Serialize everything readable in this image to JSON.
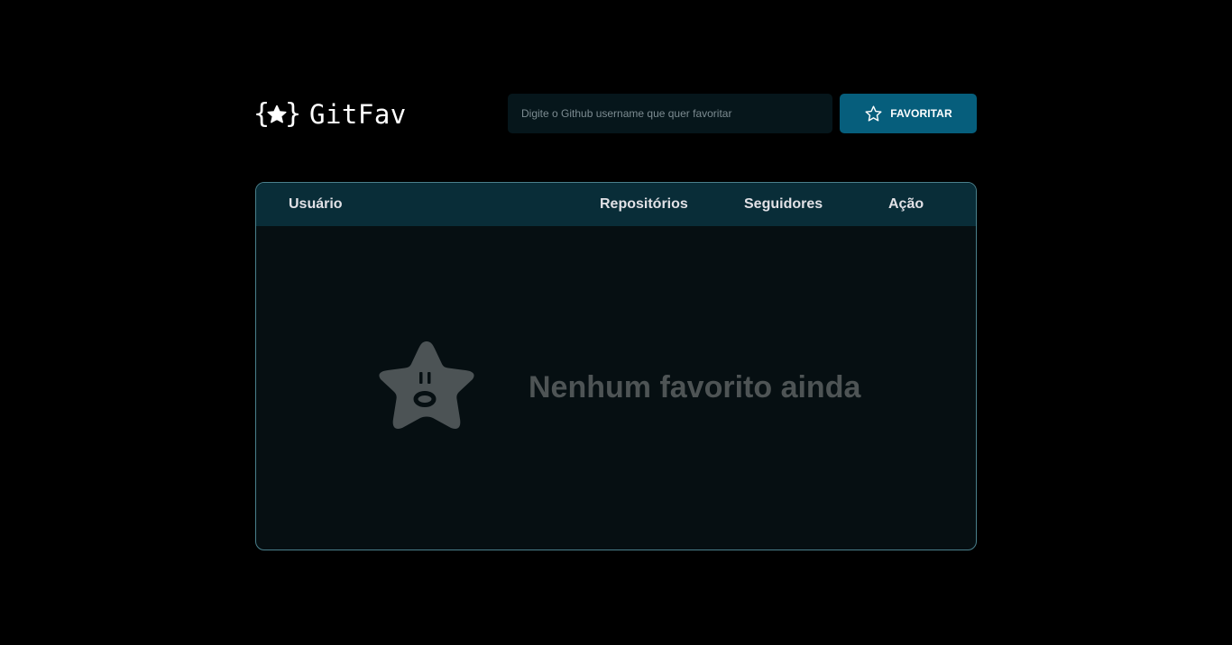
{
  "header": {
    "logo_text": "GitFav",
    "logo_icon": "curly-braces-star-icon",
    "search": {
      "placeholder": "Digite o Github username que quer favoritar",
      "value": ""
    },
    "favorite_button": {
      "label": "FAVORITAR",
      "icon": "star-outline-icon"
    }
  },
  "table": {
    "columns": [
      "Usuário",
      "Repositórios",
      "Seguidores",
      "Ação"
    ],
    "rows": [],
    "empty_state": {
      "icon": "surprised-star-icon",
      "message": "Nenhum favorito ainda"
    }
  },
  "colors": {
    "background": "#000000",
    "accent": "#065e7c",
    "table_header": "#092d38",
    "table_body": "#060f12",
    "table_border": "#4a808c",
    "empty_text": "#4e5455"
  }
}
